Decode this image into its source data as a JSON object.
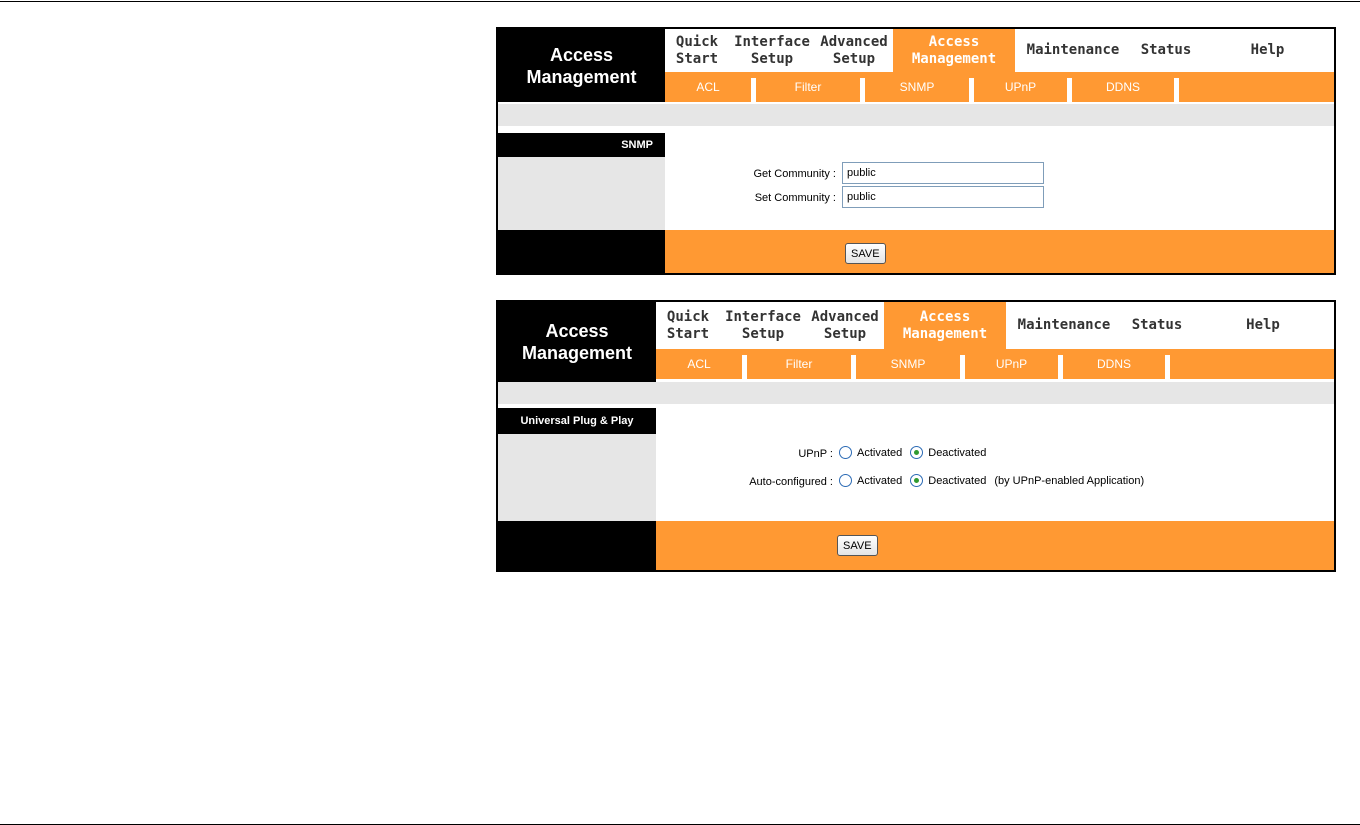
{
  "brand": {
    "line1": "Access",
    "line2": "Management"
  },
  "nav": [
    {
      "line1": "Quick",
      "line2": "Start",
      "active": false
    },
    {
      "line1": "Interface",
      "line2": "Setup",
      "active": false
    },
    {
      "line1": "Advanced",
      "line2": "Setup",
      "active": false
    },
    {
      "line1": "Access",
      "line2": "Management",
      "active": true
    },
    {
      "line1": "Maintenance",
      "line2": "",
      "active": false
    },
    {
      "line1": "Status",
      "line2": "",
      "active": false
    },
    {
      "line1": "Help",
      "line2": "",
      "active": false
    }
  ],
  "subnav": [
    "ACL",
    "Filter",
    "SNMP",
    "UPnP",
    "DDNS"
  ],
  "snmp": {
    "section_title": "SNMP",
    "get_label": "Get Community :",
    "get_value": "public",
    "set_label": "Set Community :",
    "set_value": "public",
    "save_label": "SAVE"
  },
  "upnp": {
    "section_title": "Universal Plug & Play",
    "upnp_label": "UPnP :",
    "upnp_options": [
      "Activated",
      "Deactivated"
    ],
    "upnp_selected": "Deactivated",
    "auto_label": "Auto-configured :",
    "auto_options": [
      "Activated",
      "Deactivated"
    ],
    "auto_selected": "Deactivated",
    "auto_note": "(by UPnP-enabled Application)",
    "save_label": "SAVE"
  },
  "colors": {
    "accent": "#ff9933",
    "dark": "#000000",
    "band": "#e6e6e6"
  }
}
